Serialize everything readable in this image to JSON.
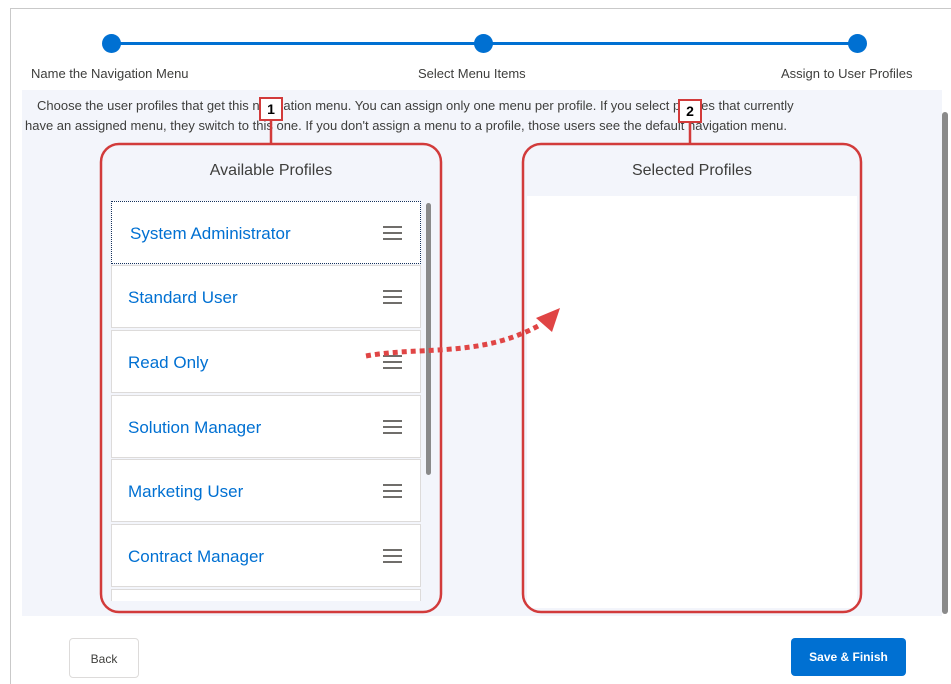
{
  "progress": {
    "steps": [
      {
        "label": "Name the Navigation Menu"
      },
      {
        "label": "Select Menu Items"
      },
      {
        "label": "Assign to User Profiles"
      }
    ],
    "color": "#0070d2"
  },
  "instructions": {
    "line1": "Choose the user profiles that get this navigation menu. You can assign only one menu per profile. If you select profiles that currently",
    "line2": "have an assigned menu, they switch to this one. If you don't assign a menu to a profile, those users see the default navigation menu."
  },
  "available": {
    "title": "Available Profiles",
    "items": [
      {
        "label": "System Administrator"
      },
      {
        "label": "Standard User"
      },
      {
        "label": "Read Only"
      },
      {
        "label": "Solution Manager"
      },
      {
        "label": "Marketing User"
      },
      {
        "label": "Contract Manager"
      }
    ]
  },
  "selected": {
    "title": "Selected Profiles"
  },
  "callouts": {
    "one": "1",
    "two": "2",
    "color": "#d23b3b"
  },
  "footer": {
    "back_label": "Back",
    "save_label": "Save & Finish"
  }
}
